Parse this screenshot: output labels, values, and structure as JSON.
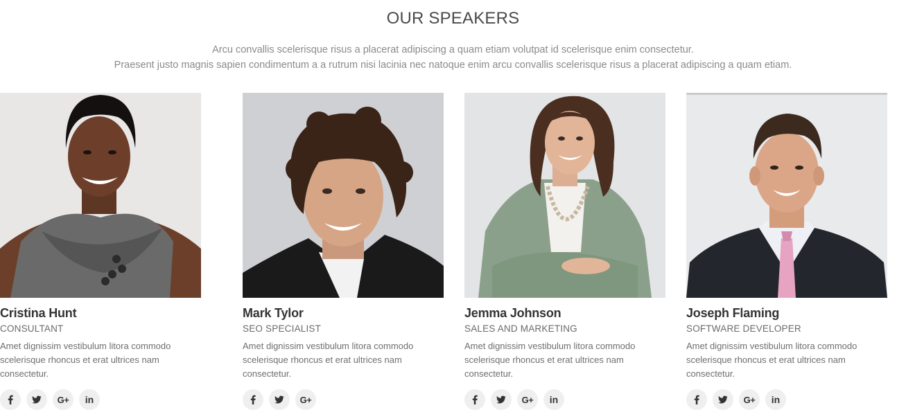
{
  "section": {
    "title": "OUR SPEAKERS",
    "intro_line1": "Arcu convallis scelerisque risus a placerat adipiscing a quam etiam volutpat id scelerisque enim consectetur.",
    "intro_line2": "Praesent justo magnis sapien condimentum a a rutrum nisi lacinia nec natoque enim arcu convallis scelerisque risus a placerat adipiscing a quam etiam."
  },
  "speakers": [
    {
      "name": "Mark Tylor",
      "role": "SEO SPECIALIST",
      "bio": "Amet dignissim vestibulum litora commodo scelerisque rhoncus et erat ultrices nam consectetur.",
      "socials": [
        "facebook",
        "twitter",
        "google-plus"
      ]
    },
    {
      "name": "Jemma Johnson",
      "role": "SALES AND MARKETING",
      "bio": "Amet dignissim vestibulum litora commodo scelerisque rhoncus et erat ultrices nam consectetur.",
      "socials": [
        "facebook",
        "twitter",
        "google-plus",
        "linkedin"
      ]
    },
    {
      "name": "Joseph Flaming",
      "role": "SOFTWARE DEVELOPER",
      "bio": "Amet dignissim vestibulum litora commodo scelerisque rhoncus et erat ultrices nam consectetur.",
      "socials": [
        "facebook",
        "twitter",
        "google-plus",
        "linkedin"
      ]
    },
    {
      "name": "Cristina Hunt",
      "role": "CONSULTANT",
      "bio": "Amet dignissim vestibulum litora commodo scelerisque rhoncus et erat ultrices nam consectetur.",
      "socials": [
        "facebook",
        "twitter",
        "google-plus",
        "linkedin"
      ]
    }
  ],
  "icons": {
    "facebook": "facebook-icon",
    "twitter": "twitter-icon",
    "google-plus": "google-plus-icon",
    "linkedin": "linkedin-icon"
  },
  "colors": {
    "title": "#4a4a4a",
    "intro": "#8a8a8a",
    "social_bg": "#efefef"
  }
}
